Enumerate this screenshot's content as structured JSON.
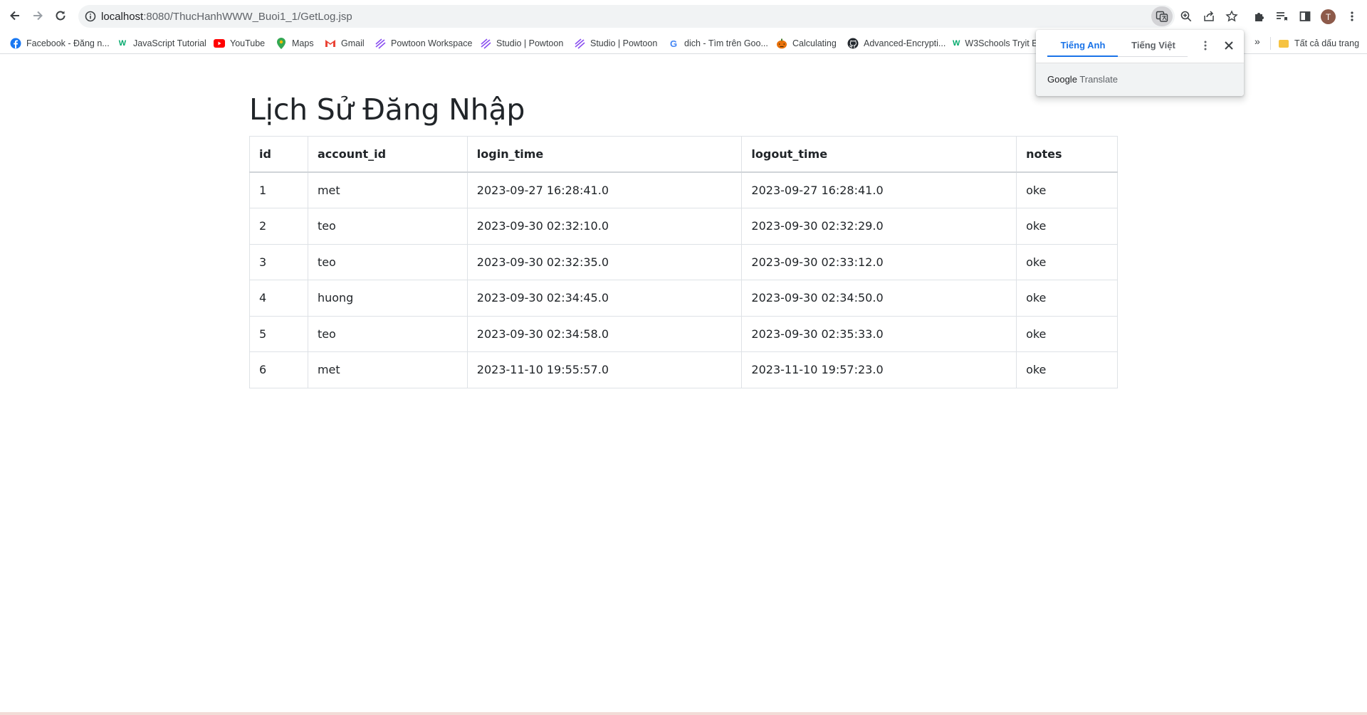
{
  "browser": {
    "url_host": "localhost",
    "url_path": ":8080/ThucHanhWWW_Buoi1_1/GetLog.jsp",
    "profile_initial": "T",
    "bookmarks": [
      {
        "label": "Facebook - Đăng n...",
        "icon": "facebook-icon"
      },
      {
        "label": "JavaScript Tutorial",
        "icon": "w3schools-icon"
      },
      {
        "label": "YouTube",
        "icon": "youtube-icon"
      },
      {
        "label": "Maps",
        "icon": "maps-icon"
      },
      {
        "label": "Gmail",
        "icon": "gmail-icon"
      },
      {
        "label": "Powtoon Workspace",
        "icon": "powtoon-icon"
      },
      {
        "label": "Studio | Powtoon",
        "icon": "powtoon-icon"
      },
      {
        "label": "Studio | Powtoon",
        "icon": "powtoon-icon"
      },
      {
        "label": "dich - Tìm trên Goo...",
        "icon": "google-icon"
      },
      {
        "label": "Calculating",
        "icon": "pumpkin-icon"
      },
      {
        "label": "Advanced-Encrypti...",
        "icon": "github-icon"
      },
      {
        "label": "W3Schools Tryit E",
        "icon": "w3schools-icon"
      }
    ],
    "more_bookmarks": "»",
    "all_bookmarks": "Tất cả dấu trang"
  },
  "translate": {
    "tab_source": "Tiếng Anh",
    "tab_target": "Tiếng Việt",
    "brand_google": "Google",
    "brand_translate": "Translate"
  },
  "page": {
    "title": "Lịch Sử Đăng Nhập",
    "columns": [
      "id",
      "account_id",
      "login_time",
      "logout_time",
      "notes"
    ],
    "rows": [
      [
        "1",
        "met",
        "2023-09-27 16:28:41.0",
        "2023-09-27 16:28:41.0",
        "oke"
      ],
      [
        "2",
        "teo",
        "2023-09-30 02:32:10.0",
        "2023-09-30 02:32:29.0",
        "oke"
      ],
      [
        "3",
        "teo",
        "2023-09-30 02:32:35.0",
        "2023-09-30 02:33:12.0",
        "oke"
      ],
      [
        "4",
        "huong",
        "2023-09-30 02:34:45.0",
        "2023-09-30 02:34:50.0",
        "oke"
      ],
      [
        "5",
        "teo",
        "2023-09-30 02:34:58.0",
        "2023-09-30 02:35:33.0",
        "oke"
      ],
      [
        "6",
        "met",
        "2023-11-10 19:55:57.0",
        "2023-11-10 19:57:23.0",
        "oke"
      ]
    ]
  },
  "colors": {
    "accent": "#1a73e8",
    "text": "#212529",
    "border": "#dee2e6"
  }
}
